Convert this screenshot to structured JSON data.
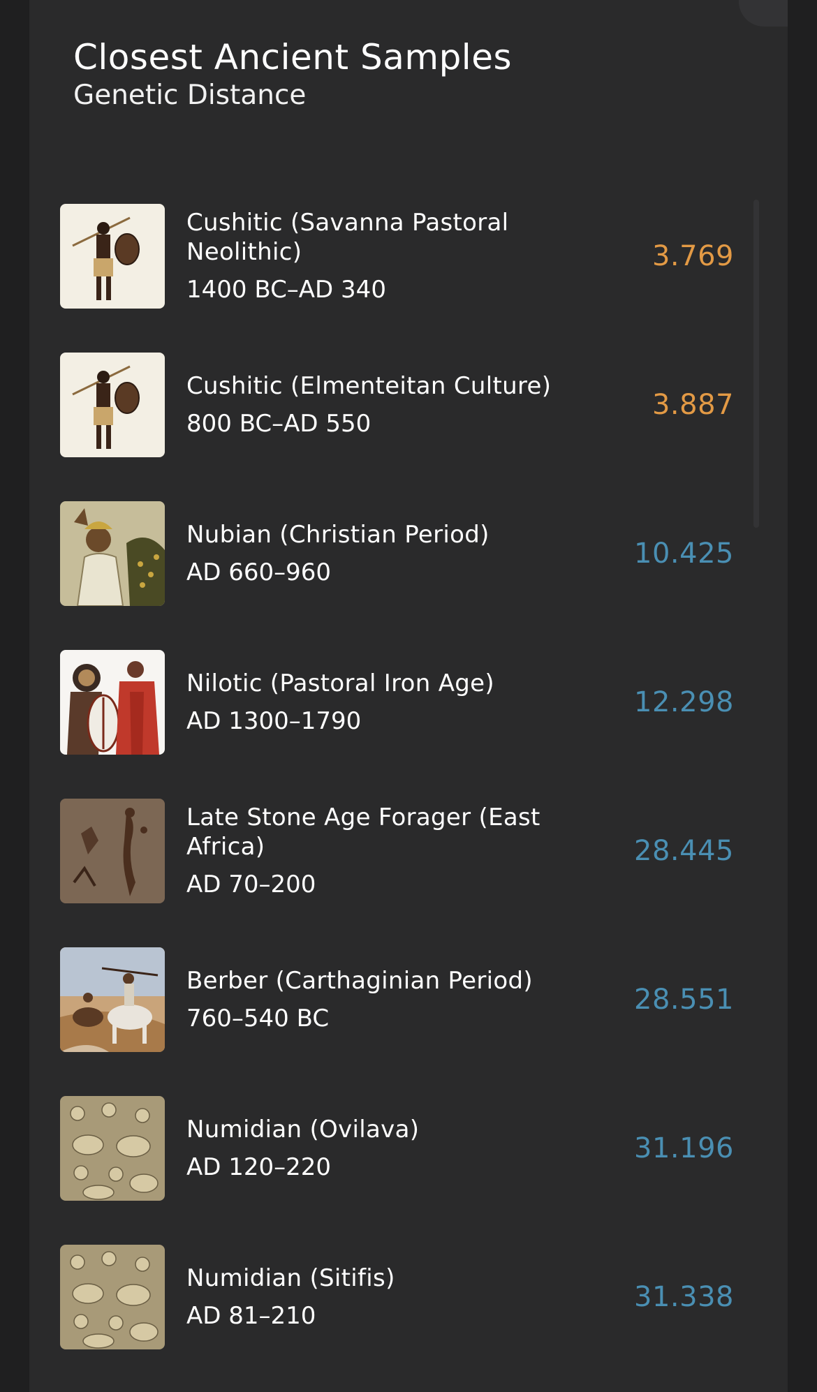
{
  "header": {
    "title": "Closest Ancient Samples",
    "subtitle": "Genetic Distance"
  },
  "colors": {
    "close_distance": "#e39a45",
    "far_distance": "#4a8fb3",
    "background": "#2a2a2b"
  },
  "samples": [
    {
      "name": "Cushitic (Savanna Pastoral Neolithic)",
      "dates": "1400 BC–AD 340",
      "distance": "3.769",
      "tier": "close",
      "image": "cushitic-warrior-image"
    },
    {
      "name": "Cushitic (Elmenteitan Culture)",
      "dates": "800 BC–AD 550",
      "distance": "3.887",
      "tier": "close",
      "image": "cushitic-warrior-image"
    },
    {
      "name": "Nubian (Christian Period)",
      "dates": "AD 660–960",
      "distance": "10.425",
      "tier": "far",
      "image": "nubian-fresco-image"
    },
    {
      "name": "Nilotic (Pastoral Iron Age)",
      "dates": "AD 1300–1790",
      "distance": "12.298",
      "tier": "far",
      "image": "nilotic-herders-image"
    },
    {
      "name": "Late Stone Age Forager (East Africa)",
      "dates": "AD 70–200",
      "distance": "28.445",
      "tier": "far",
      "image": "rock-art-image"
    },
    {
      "name": "Berber (Carthaginian Period)",
      "dates": "760–540 BC",
      "distance": "28.551",
      "tier": "far",
      "image": "berber-riders-image"
    },
    {
      "name": "Numidian (Ovilava)",
      "dates": "AD 120–220",
      "distance": "31.196",
      "tier": "far",
      "image": "relief-carving-image"
    },
    {
      "name": "Numidian (Sitifis)",
      "dates": "AD 81–210",
      "distance": "31.338",
      "tier": "far",
      "image": "relief-carving-image"
    }
  ]
}
